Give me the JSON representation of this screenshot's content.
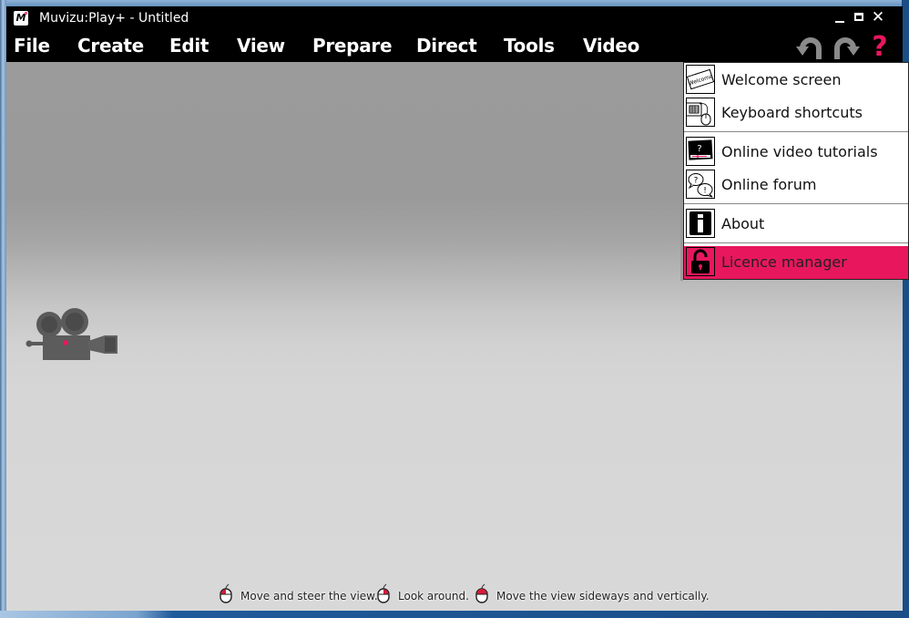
{
  "window": {
    "title": "Muvizu:Play+ - Untitled",
    "logo_text": "M",
    "controls": {
      "minimize": "minimize",
      "maximize": "maximize",
      "close": "✕"
    }
  },
  "menubar": {
    "items": [
      {
        "label": "File"
      },
      {
        "label": "Create"
      },
      {
        "label": "Edit"
      },
      {
        "label": "View"
      },
      {
        "label": "Prepare"
      },
      {
        "label": "Direct"
      },
      {
        "label": "Tools"
      },
      {
        "label": "Video"
      }
    ],
    "toolbar": {
      "undo_icon": "undo-arrow-icon",
      "redo_icon": "redo-arrow-icon",
      "help_label": "?"
    }
  },
  "help_menu": {
    "items": [
      {
        "label": "Welcome screen",
        "icon": "welcome-card-icon",
        "active": false
      },
      {
        "label": "Keyboard shortcuts",
        "icon": "keyboard-mouse-icon",
        "active": false
      },
      {
        "label": "Online video tutorials",
        "icon": "video-screen-question-icon",
        "active": false
      },
      {
        "label": "Online forum",
        "icon": "speech-bubbles-icon",
        "active": false
      },
      {
        "label": "About",
        "icon": "info-icon",
        "active": false
      },
      {
        "label": "Licence manager",
        "icon": "padlock-open-icon",
        "active": true
      }
    ],
    "welcome_icon_text": "Welcome",
    "accent_color": "#e8175d"
  },
  "viewport": {
    "object": "camera-icon",
    "hints": [
      {
        "mouse_button": "left",
        "text": "Move and steer the view."
      },
      {
        "mouse_button": "right",
        "text": "Look around."
      },
      {
        "mouse_button": "both",
        "text": "Move the view sideways and vertically."
      }
    ]
  }
}
